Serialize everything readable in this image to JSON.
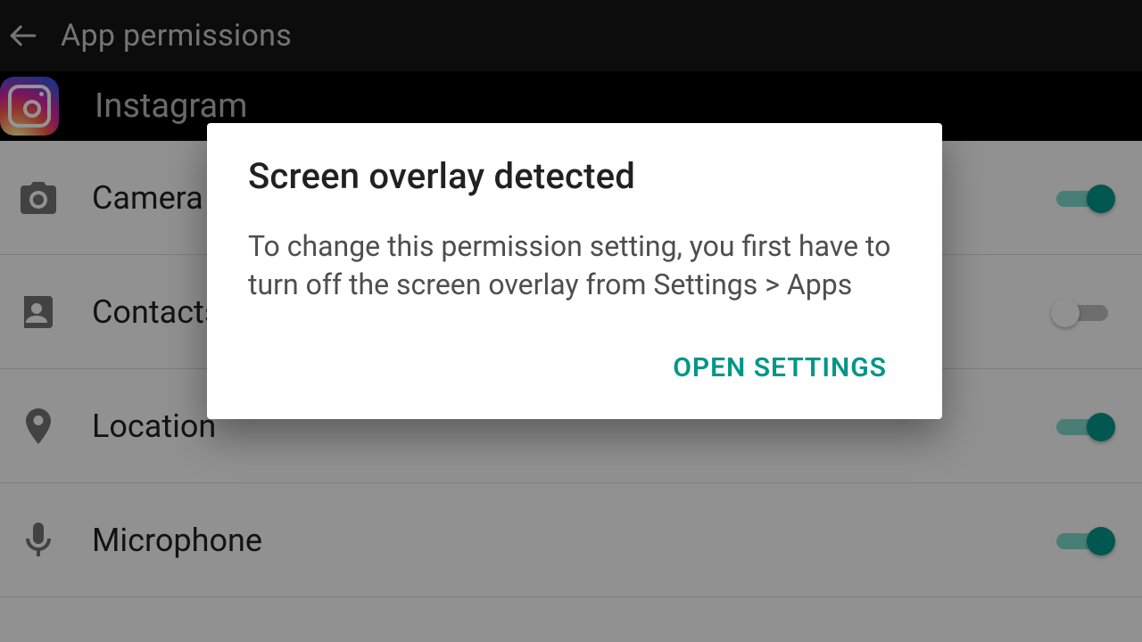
{
  "header": {
    "title": "App permissions"
  },
  "app": {
    "name": "Instagram"
  },
  "permissions": [
    {
      "icon": "camera",
      "label": "Camera",
      "on": true
    },
    {
      "icon": "contacts",
      "label": "Contacts",
      "on": false
    },
    {
      "icon": "location",
      "label": "Location",
      "on": true
    },
    {
      "icon": "microphone",
      "label": "Microphone",
      "on": true
    }
  ],
  "dialog": {
    "title": "Screen overlay detected",
    "body": "To change this permission setting, you first have to turn off the screen overlay from Settings > Apps",
    "action": "OPEN SETTINGS"
  },
  "colors": {
    "accent": "#009688"
  }
}
